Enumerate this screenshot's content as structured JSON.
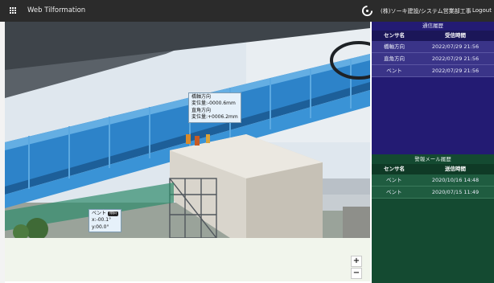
{
  "header": {
    "app_title": "Web Tilformation",
    "company": "(株)ソーキ建設/システム営業部工事",
    "logout_label": "Logout"
  },
  "map": {
    "zoom_in_label": "+",
    "zoom_out_label": "−",
    "callout_1": {
      "line1": "橋軸方向",
      "line2": "変位量:-0000.6mm",
      "line3": "直角方向",
      "line4": "変位量:+0006.2mm"
    },
    "callout_2": {
      "line1": "ベント",
      "tag": "傾斜",
      "line2": "x:-00.1°",
      "line3": "y:00.0°"
    }
  },
  "comm_history": {
    "title": "通信履歴",
    "headers": {
      "sensor": "センサ名",
      "time": "受信時間"
    },
    "rows": [
      {
        "sensor": "橋軸方向",
        "time": "2022/07/29 21:56"
      },
      {
        "sensor": "直角方向",
        "time": "2022/07/29 21:56"
      },
      {
        "sensor": "ベント",
        "time": "2022/07/29 21:56"
      }
    ]
  },
  "alert_history": {
    "title": "警報メール履歴",
    "headers": {
      "sensor": "センサ名",
      "time": "送信時間"
    },
    "rows": [
      {
        "sensor": "ベント",
        "time": "2020/10/16 14:48"
      },
      {
        "sensor": "ベント",
        "time": "2020/07/15 11:49"
      }
    ]
  },
  "colors": {
    "header_bg": "#2b2b2b",
    "comm_panel": "#231b73",
    "alert_panel": "#144a31",
    "girder_blue": "#2d83c9"
  }
}
